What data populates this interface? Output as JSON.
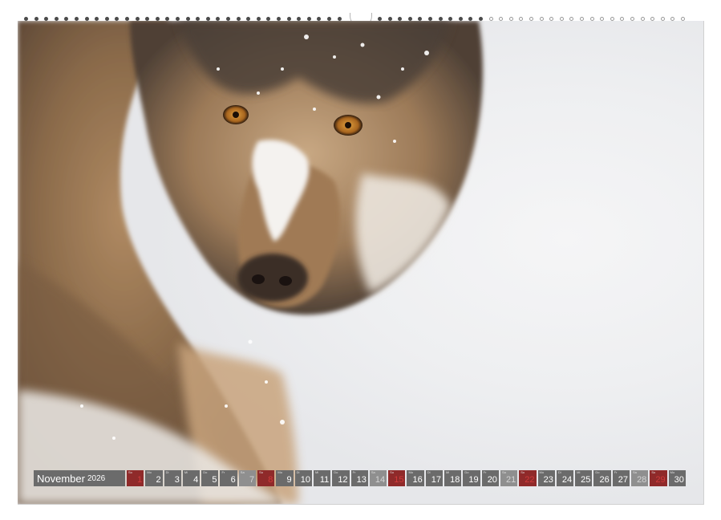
{
  "calendar": {
    "month": "November",
    "year": "2026"
  },
  "days": [
    {
      "d": "1",
      "wd": "So",
      "type": "sun"
    },
    {
      "d": "2",
      "wd": "Mo",
      "type": "work"
    },
    {
      "d": "3",
      "wd": "Di",
      "type": "work"
    },
    {
      "d": "4",
      "wd": "Mi",
      "type": "work"
    },
    {
      "d": "5",
      "wd": "Do",
      "type": "work"
    },
    {
      "d": "6",
      "wd": "Fr",
      "type": "work"
    },
    {
      "d": "7",
      "wd": "Sa",
      "type": "weekend"
    },
    {
      "d": "8",
      "wd": "So",
      "type": "sun"
    },
    {
      "d": "9",
      "wd": "Mo",
      "type": "work"
    },
    {
      "d": "10",
      "wd": "Di",
      "type": "work"
    },
    {
      "d": "11",
      "wd": "Mi",
      "type": "work"
    },
    {
      "d": "12",
      "wd": "Do",
      "type": "work"
    },
    {
      "d": "13",
      "wd": "Fr",
      "type": "work"
    },
    {
      "d": "14",
      "wd": "Sa",
      "type": "weekend"
    },
    {
      "d": "15",
      "wd": "So",
      "type": "sun"
    },
    {
      "d": "16",
      "wd": "Mo",
      "type": "work"
    },
    {
      "d": "17",
      "wd": "Di",
      "type": "work"
    },
    {
      "d": "18",
      "wd": "Mi",
      "type": "work"
    },
    {
      "d": "19",
      "wd": "Do",
      "type": "work"
    },
    {
      "d": "20",
      "wd": "Fr",
      "type": "work"
    },
    {
      "d": "21",
      "wd": "Sa",
      "type": "weekend"
    },
    {
      "d": "22",
      "wd": "So",
      "type": "sun"
    },
    {
      "d": "23",
      "wd": "Mo",
      "type": "work"
    },
    {
      "d": "24",
      "wd": "Di",
      "type": "work"
    },
    {
      "d": "25",
      "wd": "Mi",
      "type": "work"
    },
    {
      "d": "26",
      "wd": "Do",
      "type": "work"
    },
    {
      "d": "27",
      "wd": "Fr",
      "type": "work"
    },
    {
      "d": "28",
      "wd": "Sa",
      "type": "weekend"
    },
    {
      "d": "29",
      "wd": "So",
      "type": "sun"
    },
    {
      "d": "30",
      "wd": "Mo",
      "type": "work"
    }
  ],
  "colors": {
    "bar": "#6b6b6b",
    "weekend": "#8f8f8f",
    "sunday": "#cf3b3b"
  },
  "photo": {
    "subject_icon": "wolf-in-snow-photo"
  }
}
